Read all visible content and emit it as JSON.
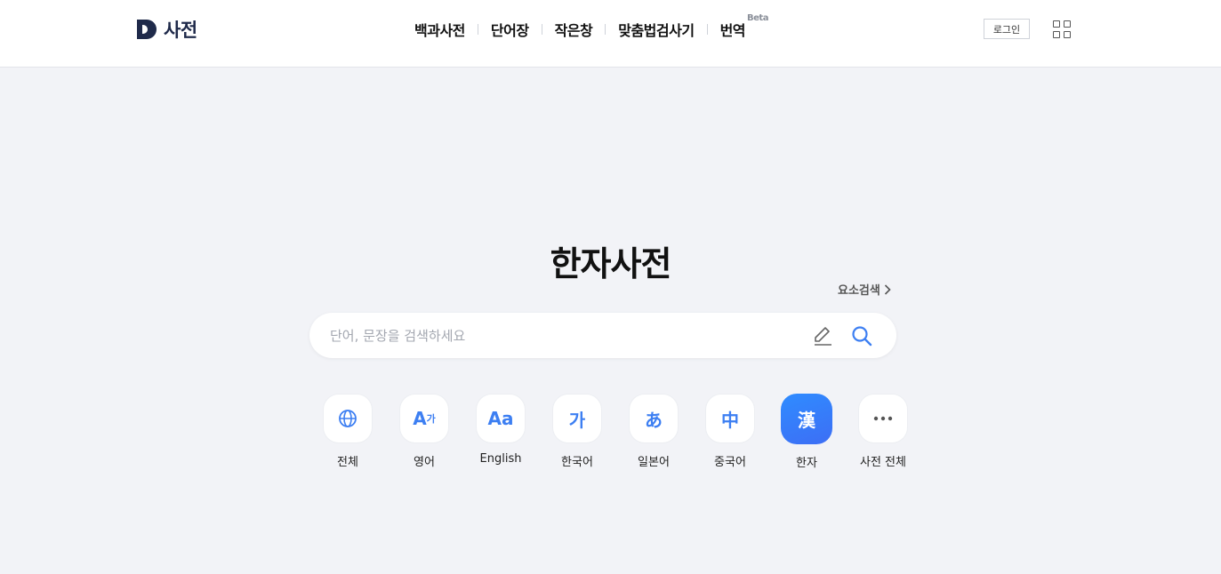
{
  "header": {
    "logo_text": "사전",
    "nav": [
      {
        "label": "백과사전"
      },
      {
        "label": "단어장"
      },
      {
        "label": "작은창"
      },
      {
        "label": "맞춤법검사기"
      },
      {
        "label": "번역",
        "badge": "Beta"
      }
    ],
    "login_label": "로그인"
  },
  "main": {
    "title": "한자사전",
    "element_search_label": "요소검색",
    "search": {
      "placeholder": "단어, 문장을 검색하세요",
      "value": ""
    },
    "categories": [
      {
        "label": "전체",
        "icon": "globe-icon"
      },
      {
        "label": "영어",
        "icon_text_big": "A",
        "icon_text_small": "가"
      },
      {
        "label": "English",
        "icon_text": "Aa"
      },
      {
        "label": "한국어",
        "icon_text": "가"
      },
      {
        "label": "일본어",
        "icon_text": "あ"
      },
      {
        "label": "중국어",
        "icon_text": "中"
      },
      {
        "label": "한자",
        "icon_text": "漢",
        "active": true
      },
      {
        "label": "사전 전체",
        "icon": "more-icon"
      }
    ]
  },
  "colors": {
    "accent": "#3d7ff2",
    "brand": "#1f2a4a",
    "background": "#f2f3f7"
  }
}
